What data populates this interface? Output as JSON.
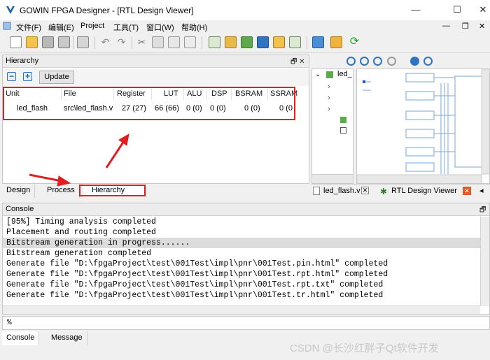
{
  "window": {
    "title": "GOWIN FPGA Designer - [RTL Design Viewer]",
    "minimize_glyph": "—",
    "maximize_glyph": "☐",
    "close_glyph": "✕"
  },
  "menu": {
    "file": "文件(F)",
    "edit": "编辑(E)",
    "project": "Project",
    "tools": "工具(T)",
    "window": "窗口(W)",
    "help": "帮助(H)",
    "right_min": "—",
    "right_restore": "❐",
    "right_close": "✕"
  },
  "hierarchy": {
    "title": "Hierarchy",
    "panel_ctl": "🗗 ✕",
    "collapse": "−",
    "expand": "+",
    "update_label": "Update",
    "columns": [
      "Unit",
      "File",
      "Register",
      "LUT",
      "ALU",
      "DSP",
      "BSRAM",
      "SSRAM"
    ],
    "rows": [
      {
        "unit": "led_flash",
        "file": "src\\led_flash.v",
        "register": "27 (27)",
        "lut": "66 (66)",
        "alu": "0 (0)",
        "dsp": "0 (0)",
        "bsram": "0 (0)",
        "ssram": "0 (0"
      }
    ]
  },
  "tree": {
    "root": "led_"
  },
  "lower_tabs": [
    "Design",
    "Process",
    "Hierarchy"
  ],
  "editor_tabs": {
    "file_tab": "led_flash.v",
    "rtl_tab": "RTL Design Viewer"
  },
  "console": {
    "title": "Console",
    "panel_ctl": "🗗",
    "lines": [
      "[95%] Timing analysis completed",
      "Placement and routing completed",
      "Bitstream generation in progress......",
      "Bitstream generation completed",
      "Generate file \"D:\\fpgaProject\\test\\001Test\\impl\\pnr\\001Test.pin.html\" completed",
      "Generate file \"D:\\fpgaProject\\test\\001Test\\impl\\pnr\\001Test.rpt.html\" completed",
      "Generate file \"D:\\fpgaProject\\test\\001Test\\impl\\pnr\\001Test.rpt.txt\" completed",
      "Generate file \"D:\\fpgaProject\\test\\001Test\\impl\\pnr\\001Test.tr.html\" completed"
    ],
    "highlight_index": 2,
    "prompt": "%"
  },
  "bottom_tabs": [
    "Console",
    "Message"
  ],
  "watermark": "CSDN @长沙红胖子Qt软件开发",
  "colors": {
    "annotation_red": "#e02020",
    "logo_blue": "#1c5fa8"
  }
}
